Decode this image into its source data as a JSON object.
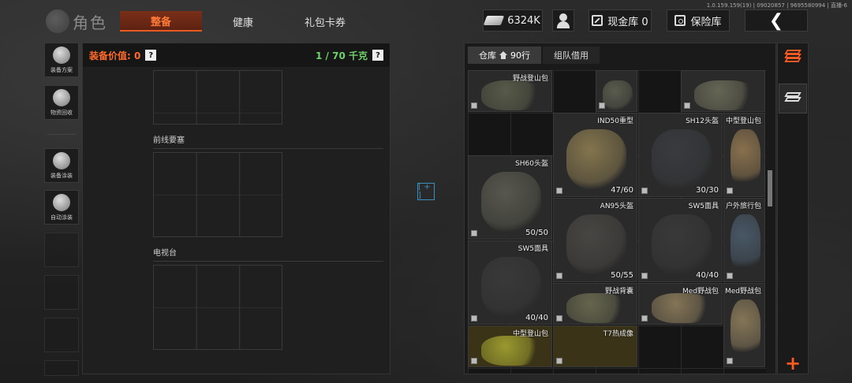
{
  "version": "1.0.159.159(19) | 09020857 | 9695580994 | 直播-6",
  "logo": {
    "title": "角色"
  },
  "tabs": [
    {
      "label": "整备",
      "active": true
    },
    {
      "label": "健康",
      "active": false
    },
    {
      "label": "礼包卡券",
      "active": false
    }
  ],
  "topbar": {
    "currency": "6324K",
    "cash_vault": "现金库 0",
    "safe": "保险库"
  },
  "sidebar": {
    "items": [
      {
        "label": "装备方案",
        "icon": "loadout-icon"
      },
      {
        "label": "物资回收",
        "icon": "recycle-icon"
      },
      {
        "label": "装备涂装",
        "icon": "paint-icon"
      },
      {
        "label": "自动涂装",
        "icon": "auto-paint-icon"
      }
    ]
  },
  "gear": {
    "value_label": "装备价值: 0",
    "weight_label": "1 / 70 千克",
    "sections": [
      "前线要塞",
      "电视台"
    ]
  },
  "warehouse": {
    "tabs": [
      {
        "label": "仓库",
        "count": "90行"
      },
      {
        "label": "组队借用"
      }
    ],
    "items": [
      {
        "name": "野战登山包",
        "dur": "",
        "col": 0,
        "row": 0,
        "w": 2,
        "h": 1,
        "color": "#5a5e4a"
      },
      {
        "name": "",
        "dur": "",
        "col": 3,
        "row": 0,
        "w": 1,
        "h": 1,
        "color": "#5c5f50"
      },
      {
        "name": "",
        "dur": "",
        "col": 5,
        "row": 0,
        "w": 2,
        "h": 1,
        "color": "#6a6a58"
      },
      {
        "name": "IND50重型",
        "dur": "47/60",
        "col": 2,
        "row": 1,
        "w": 2,
        "h": 2,
        "color": "#8a7a50"
      },
      {
        "name": "SH12头盔",
        "dur": "30/30",
        "col": 4,
        "row": 1,
        "w": 2,
        "h": 2,
        "color": "#3a3c40"
      },
      {
        "name": "中型登山包",
        "dur": "",
        "col": 6,
        "row": 1,
        "w": 1,
        "h": 2,
        "color": "#8e7550"
      },
      {
        "name": "SH60头盔",
        "dur": "50/50",
        "col": 0,
        "row": 2,
        "w": 2,
        "h": 2,
        "color": "#5a5a50"
      },
      {
        "name": "AN95头盔",
        "dur": "50/55",
        "col": 2,
        "row": 3,
        "w": 2,
        "h": 2,
        "color": "#4a4844"
      },
      {
        "name": "SW5面具",
        "dur": "40/40",
        "col": 4,
        "row": 3,
        "w": 2,
        "h": 2,
        "color": "#3a3a3a"
      },
      {
        "name": "户外旅行包",
        "dur": "",
        "col": 6,
        "row": 3,
        "w": 1,
        "h": 2,
        "color": "#4a5a6a"
      },
      {
        "name": "SW5面具",
        "dur": "40/40",
        "col": 0,
        "row": 4,
        "w": 2,
        "h": 2,
        "color": "#3a3a3a"
      },
      {
        "name": "野战背囊",
        "dur": "",
        "col": 2,
        "row": 5,
        "w": 2,
        "h": 1,
        "color": "#6a6a50"
      },
      {
        "name": "Med野战包",
        "dur": "",
        "col": 4,
        "row": 5,
        "w": 2,
        "h": 1,
        "color": "#8a7a5a"
      },
      {
        "name": "Med野战包",
        "dur": "",
        "col": 6,
        "row": 5,
        "w": 1,
        "h": 2,
        "color": "#8a7a5a"
      },
      {
        "name": "中型登山包",
        "dur": "",
        "col": 0,
        "row": 6,
        "w": 2,
        "h": 1,
        "color": "#a0a030",
        "gold": true
      },
      {
        "name": "T7热成像",
        "dur": "",
        "col": 2,
        "row": 6,
        "w": 2,
        "h": 1,
        "color": "#222",
        "gold": true
      }
    ]
  },
  "colors": {
    "accent": "#e85a22",
    "weight": "#6fd16a",
    "value": "#ff6a2a"
  }
}
